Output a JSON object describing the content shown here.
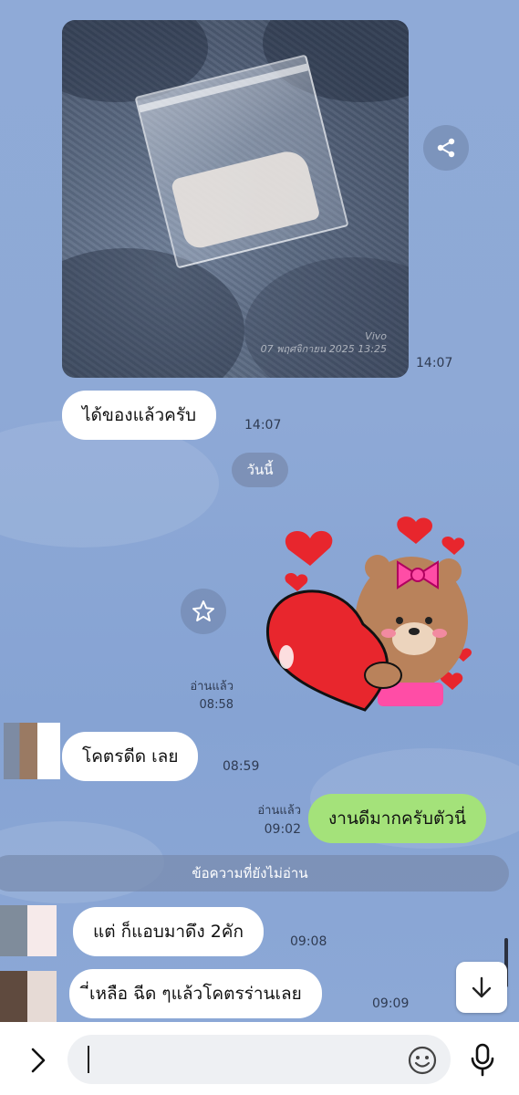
{
  "photo": {
    "stamp_line1": "Vivo",
    "stamp_line2": "07 พฤศจิกายน 2025 13:25",
    "time": "14:07"
  },
  "messages": [
    {
      "id": "m1",
      "text": "ได้ของแล้วครับ",
      "time": "14:07",
      "side": "left"
    },
    {
      "id": "m2",
      "text": "โคตรดีด เลย",
      "time": "08:59",
      "side": "left"
    },
    {
      "id": "m3",
      "text": "งานดีมากครับตัวนี่",
      "time": "09:02",
      "read": "อ่านแล้ว",
      "side": "right"
    },
    {
      "id": "m4",
      "text": "แต่ ก็แอบมาดึง 2คัก",
      "time": "09:08",
      "side": "left"
    },
    {
      "id": "m5",
      "text": "ี่เหลือ ฉีด ๆแล้วโคตรร่านเลย",
      "time": "09:09",
      "side": "left"
    }
  ],
  "date_divider": "วันนี้",
  "sticker": {
    "read": "อ่านแล้ว",
    "time": "08:58"
  },
  "unread_divider": "ข้อความที่ยังไม่อ่าน",
  "icons": {
    "share": "share-icon",
    "star": "star-icon",
    "scroll_down": "arrow-down-icon",
    "expand": "chevron-right-icon",
    "emoji": "emoji-icon",
    "mic": "microphone-icon"
  },
  "colors": {
    "chat_bg": "#8ea9d6",
    "my_bubble": "#a4e27a",
    "their_bubble": "#ffffff"
  }
}
